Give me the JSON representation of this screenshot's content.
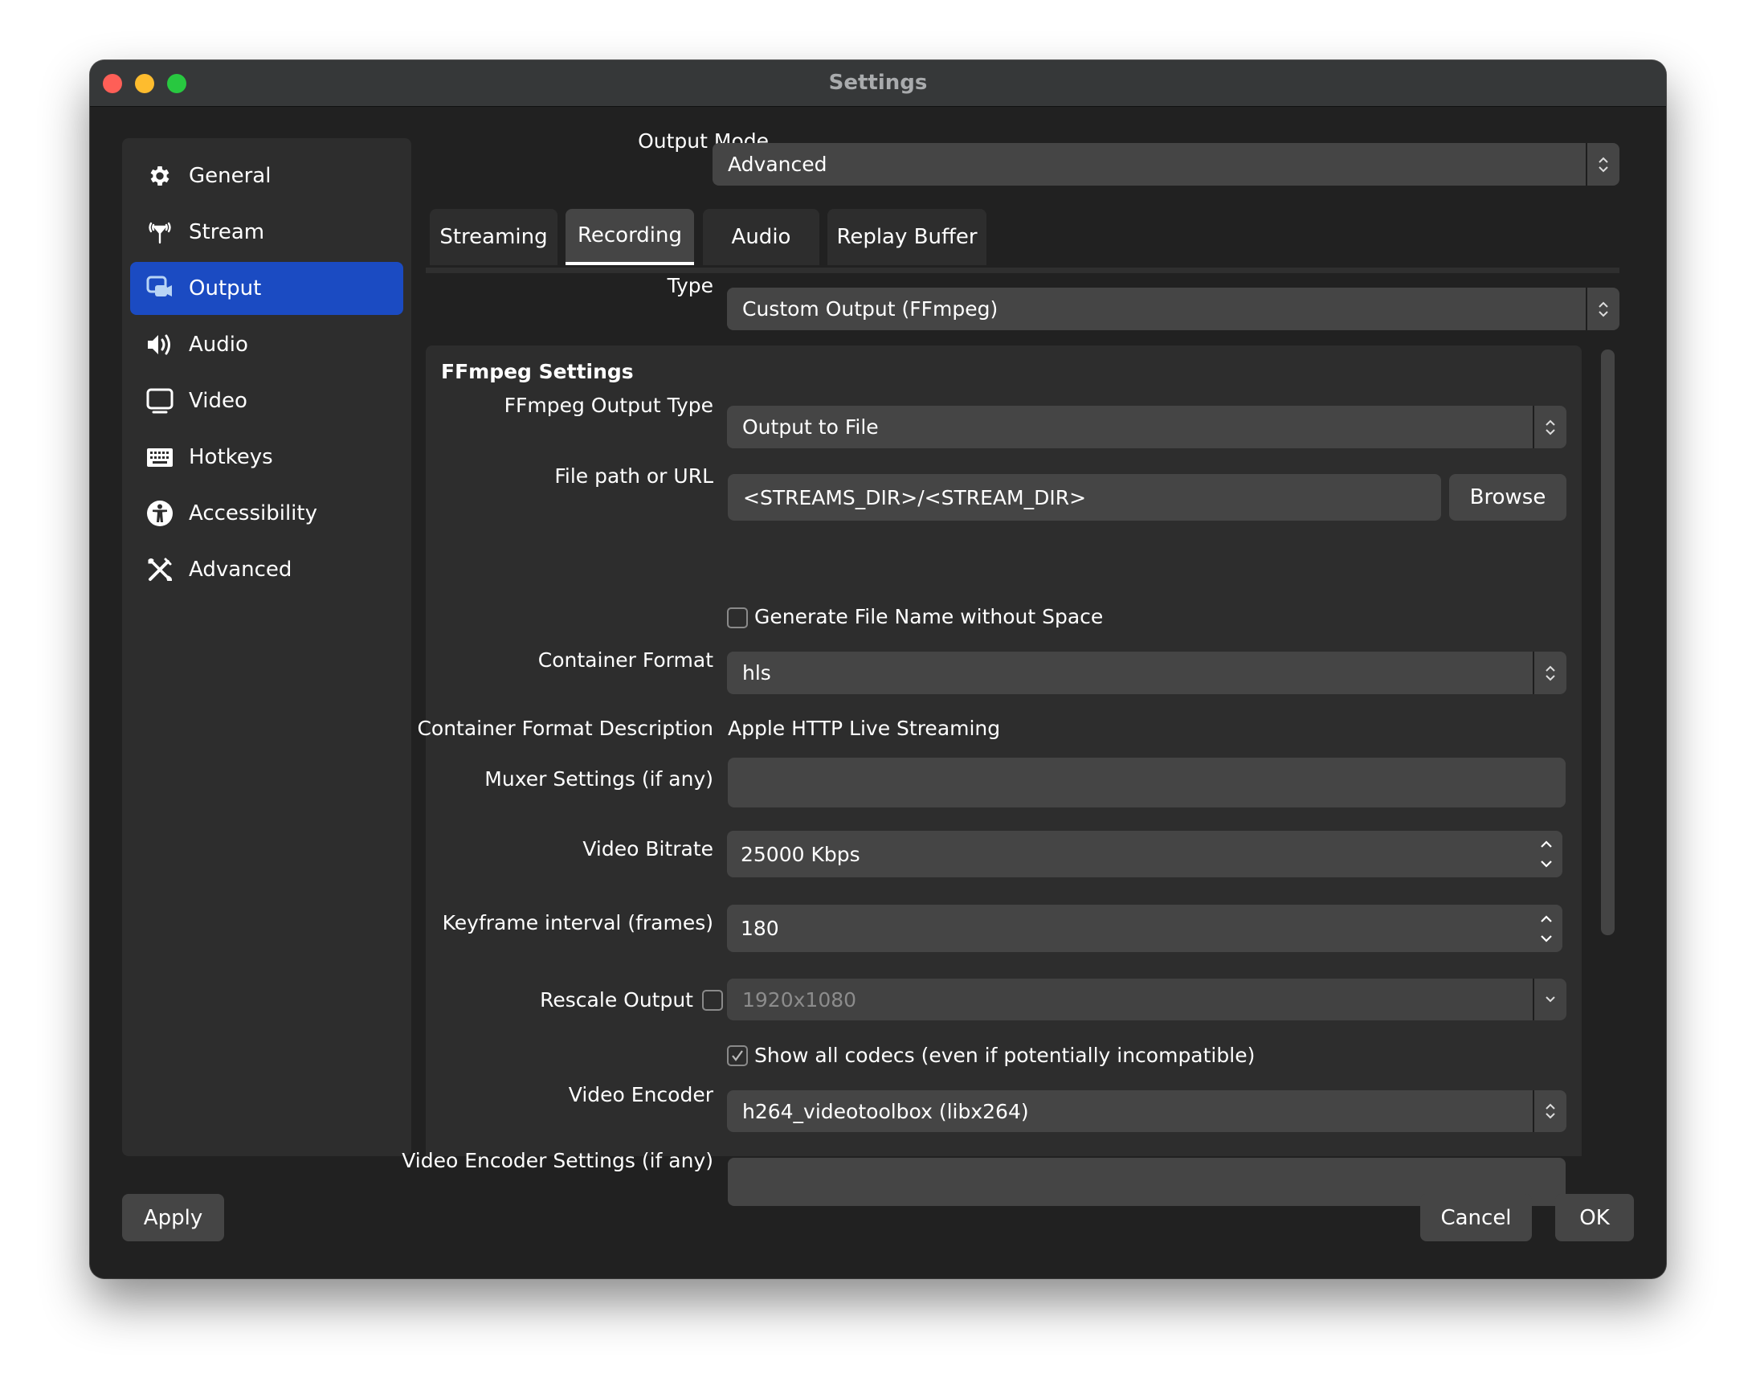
{
  "window": {
    "title": "Settings",
    "controls": [
      "close",
      "minimize",
      "maximize"
    ]
  },
  "sidebar": {
    "items": [
      {
        "label": "General",
        "icon": "gear-icon",
        "active": false
      },
      {
        "label": "Stream",
        "icon": "antenna-icon",
        "active": false
      },
      {
        "label": "Output",
        "icon": "output-camera-icon",
        "active": true
      },
      {
        "label": "Audio",
        "icon": "speaker-icon",
        "active": false
      },
      {
        "label": "Video",
        "icon": "monitor-icon",
        "active": false
      },
      {
        "label": "Hotkeys",
        "icon": "keyboard-icon",
        "active": false
      },
      {
        "label": "Accessibility",
        "icon": "accessibility-icon",
        "active": false
      },
      {
        "label": "Advanced",
        "icon": "tools-icon",
        "active": false
      }
    ]
  },
  "output_mode": {
    "label": "Output Mode",
    "value": "Advanced"
  },
  "tabs": [
    {
      "label": "Streaming",
      "active": false
    },
    {
      "label": "Recording",
      "active": true
    },
    {
      "label": "Audio",
      "active": false
    },
    {
      "label": "Replay Buffer",
      "active": false
    }
  ],
  "type": {
    "label": "Type",
    "value": "Custom Output (FFmpeg)"
  },
  "ffmpeg": {
    "title": "FFmpeg Settings",
    "output_type": {
      "label": "FFmpeg Output Type",
      "value": "Output to File"
    },
    "file_path": {
      "label": "File path or URL",
      "value": "<STREAMS_DIR>/<STREAM_DIR>",
      "browse_label": "Browse"
    },
    "generate_no_space": {
      "label": "Generate File Name without Space",
      "checked": false
    },
    "container_format": {
      "label": "Container Format",
      "value": "hls"
    },
    "container_desc": {
      "label": "Container Format Description",
      "value": "Apple HTTP Live Streaming"
    },
    "muxer_settings": {
      "label": "Muxer Settings (if any)",
      "value": ""
    },
    "video_bitrate": {
      "label": "Video Bitrate",
      "value": "25000 Kbps"
    },
    "keyframe_interval": {
      "label": "Keyframe interval (frames)",
      "value": "180"
    },
    "rescale_output": {
      "label": "Rescale Output",
      "checked": false,
      "value": "1920x1080"
    },
    "show_all_codecs": {
      "label": "Show all codecs (even if potentially incompatible)",
      "checked": true
    },
    "video_encoder": {
      "label": "Video Encoder",
      "value": "h264_videotoolbox (libx264)"
    },
    "video_encoder_settings": {
      "label": "Video Encoder Settings (if any)",
      "value": ""
    }
  },
  "footer": {
    "apply_label": "Apply",
    "cancel_label": "Cancel",
    "ok_label": "OK"
  }
}
